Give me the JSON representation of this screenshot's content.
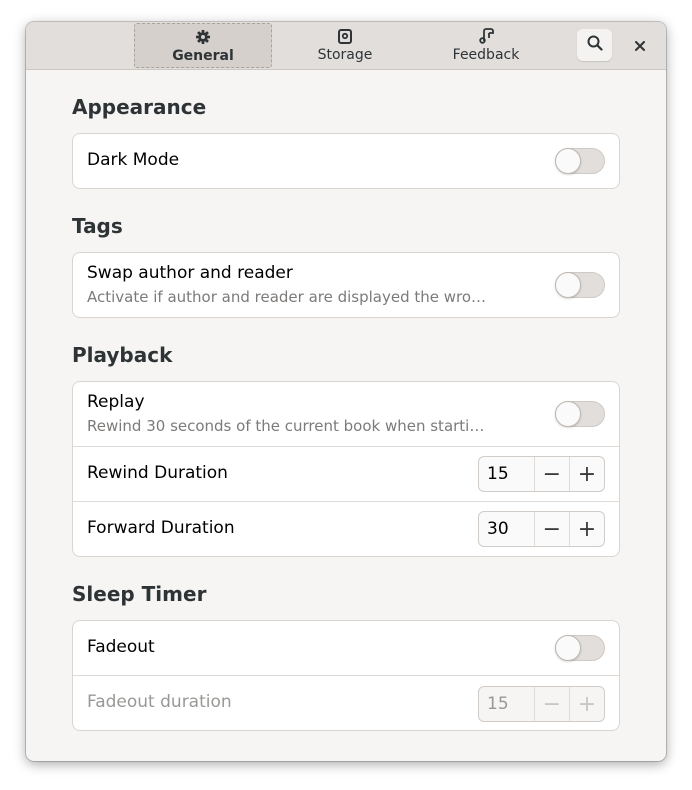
{
  "header": {
    "tabs": [
      {
        "label": "General",
        "icon": "gear-icon",
        "active": true
      },
      {
        "label": "Storage",
        "icon": "storage-icon",
        "active": false
      },
      {
        "label": "Feedback",
        "icon": "feedback-icon",
        "active": false
      }
    ],
    "search_icon": "search-icon",
    "close_icon": "close-icon"
  },
  "sections": {
    "appearance": {
      "title": "Appearance",
      "rows": [
        {
          "title": "Dark Mode",
          "switch_on": false
        }
      ]
    },
    "tags": {
      "title": "Tags",
      "rows": [
        {
          "title": "Swap author and reader",
          "subtitle": "Activate if author and reader are displayed the wro…",
          "switch_on": false
        }
      ]
    },
    "playback": {
      "title": "Playback",
      "rows": [
        {
          "title": "Replay",
          "subtitle": "Rewind 30 seconds of the current book when starti…",
          "switch_on": false
        },
        {
          "title": "Rewind Duration",
          "value": "15",
          "minus": "−",
          "plus": "+"
        },
        {
          "title": "Forward Duration",
          "value": "30",
          "minus": "−",
          "plus": "+"
        }
      ]
    },
    "sleep_timer": {
      "title": "Sleep Timer",
      "rows": [
        {
          "title": "Fadeout",
          "switch_on": false
        },
        {
          "title": "Fadeout duration",
          "value": "15",
          "minus": "−",
          "plus": "+",
          "disabled": true
        }
      ]
    }
  }
}
